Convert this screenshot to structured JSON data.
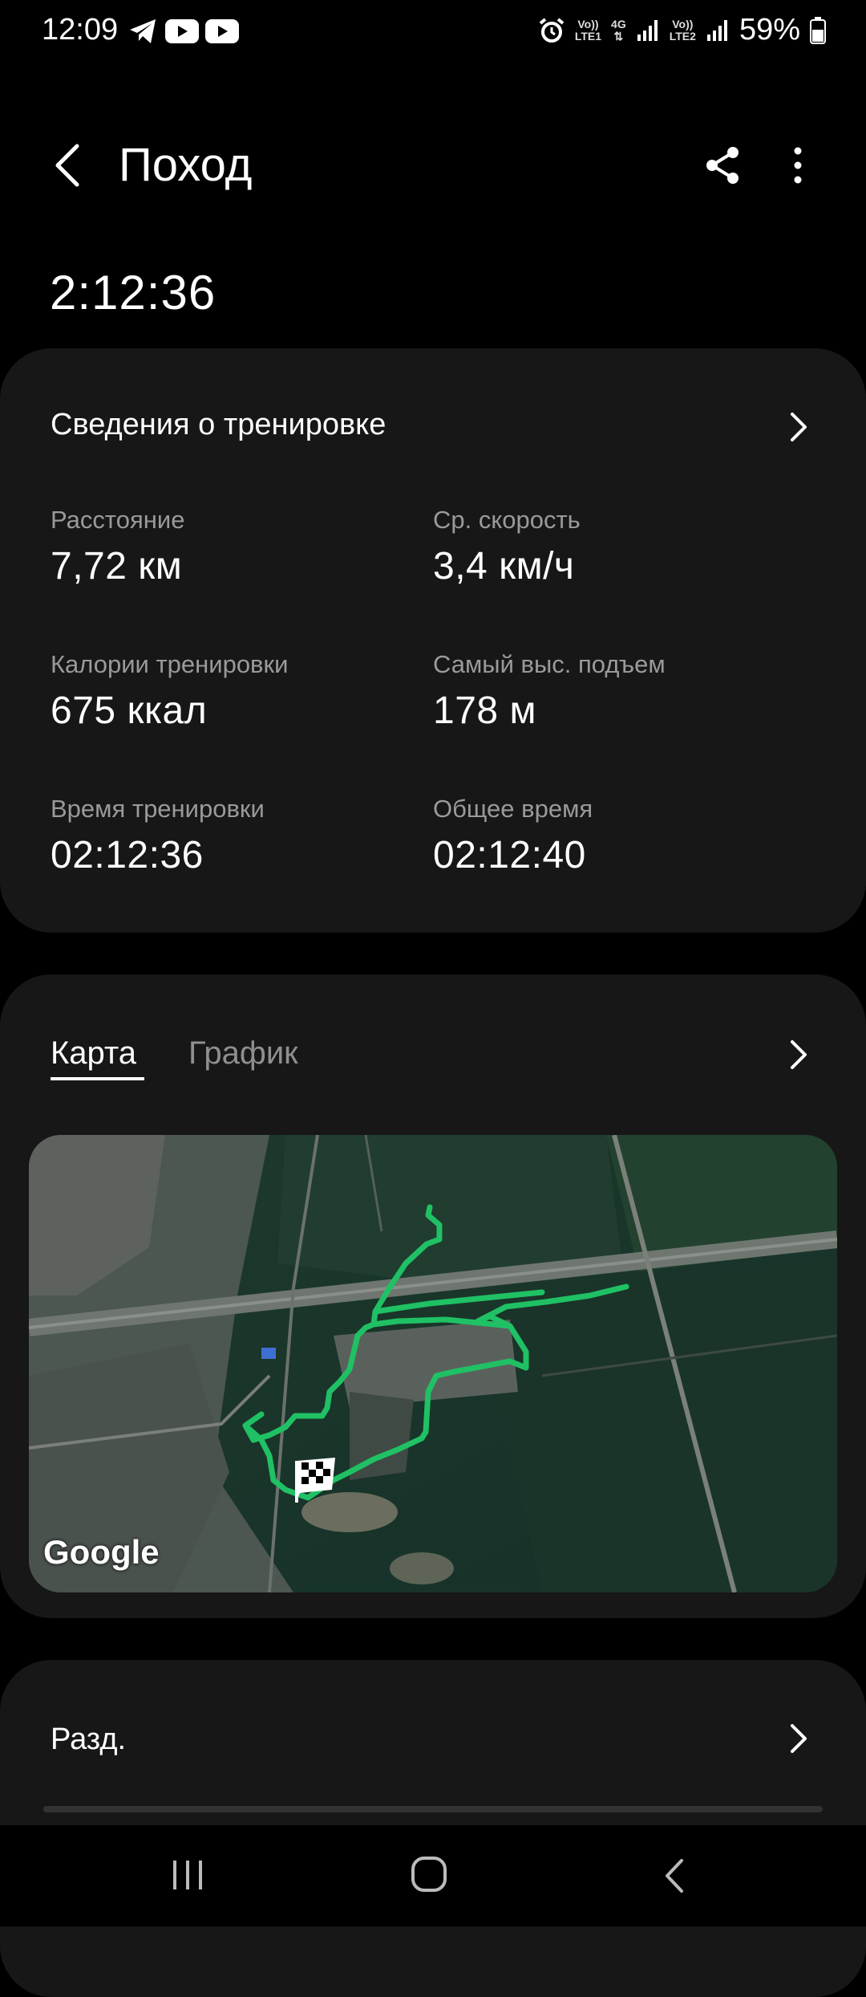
{
  "status_bar": {
    "time": "12:09",
    "net1_top": "Vo))",
    "net1_bottom": "LTE1",
    "net2_top": "4G",
    "net3_top": "Vo))",
    "net3_bottom": "LTE2",
    "battery": "59%"
  },
  "header": {
    "title": "Поход",
    "duration": "2:12:36"
  },
  "workout_details": {
    "title": "Сведения о тренировке",
    "stats": [
      {
        "label": "Расстояние",
        "value": "7,72",
        "unit": "км"
      },
      {
        "label": "Ср. скорость",
        "value": "3,4",
        "unit": "км/ч"
      },
      {
        "label": "Калории тренировки",
        "value": "675",
        "unit": "ккал"
      },
      {
        "label": "Самый выс. подъем",
        "value": "178",
        "unit": "м"
      },
      {
        "label": "Время тренировки",
        "value": "02:12:36",
        "unit": ""
      },
      {
        "label": "Общее время",
        "value": "02:12:40",
        "unit": ""
      }
    ]
  },
  "map_section": {
    "tabs": [
      "Карта",
      "График"
    ],
    "active_tab": "Карта",
    "map_attribution": "Google",
    "route_color": "#1fc164"
  },
  "splits": {
    "title": "Разд."
  }
}
